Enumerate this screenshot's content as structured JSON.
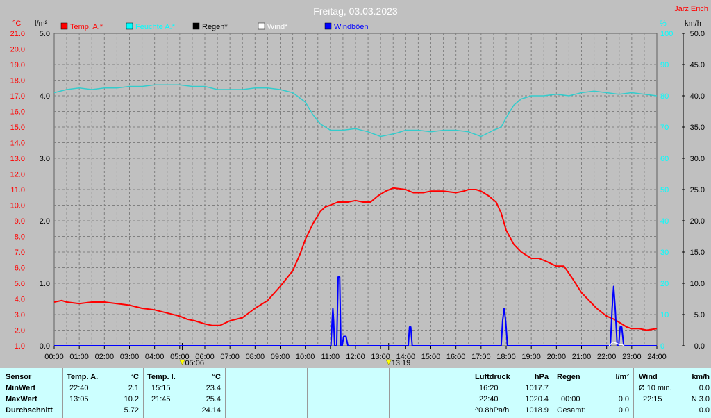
{
  "chart_data": {
    "type": "line",
    "title": "Freitag, 03.03.2023",
    "credit": "Jarz Erich",
    "x_ticks": [
      "00:00",
      "01:00",
      "02:00",
      "03:00",
      "04:00",
      "05:00",
      "06:00",
      "07:00",
      "08:00",
      "09:00",
      "10:00",
      "11:00",
      "12:00",
      "13:00",
      "14:00",
      "15:00",
      "16:00",
      "17:00",
      "18:00",
      "19:00",
      "20:00",
      "21:00",
      "22:00",
      "23:00",
      "24:00"
    ],
    "xlim": [
      0,
      24
    ],
    "axes": {
      "temp": {
        "unit": "°C",
        "min": 1.0,
        "max": 21.0,
        "ticks": [
          "1.0",
          "2.0",
          "3.0",
          "4.0",
          "5.0",
          "6.0",
          "7.0",
          "8.0",
          "9.0",
          "10.0",
          "11.0",
          "12.0",
          "13.0",
          "14.0",
          "15.0",
          "16.0",
          "17.0",
          "18.0",
          "19.0",
          "20.0",
          "21.0"
        ],
        "color": "#ff0000"
      },
      "rain": {
        "unit": "l/m²",
        "min": 0.0,
        "max": 5.0,
        "ticks": [
          "0.0",
          "1.0",
          "2.0",
          "3.0",
          "4.0",
          "5.0"
        ],
        "color": "#000000"
      },
      "humidity": {
        "unit": "%",
        "min": 0,
        "max": 100,
        "ticks": [
          "0",
          "10",
          "20",
          "30",
          "40",
          "50",
          "60",
          "70",
          "80",
          "90",
          "100"
        ],
        "color": "#00ffff"
      },
      "wind": {
        "unit": "km/h",
        "min": 0.0,
        "max": 50.0,
        "ticks": [
          "0.0",
          "5.0",
          "10.0",
          "15.0",
          "20.0",
          "25.0",
          "30.0",
          "35.0",
          "40.0",
          "45.0",
          "50.0"
        ],
        "color": "#000000"
      }
    },
    "legend": [
      {
        "name": "Temp. A.*",
        "color": "#ff0000"
      },
      {
        "name": "Feuchte A.*",
        "color": "#00ffff"
      },
      {
        "name": "Regen*",
        "color": "#000000"
      },
      {
        "name": "Wind*",
        "color": "#ffffff"
      },
      {
        "name": "Windböen",
        "color": "#0000ff"
      }
    ],
    "markers": [
      {
        "label": "05:06",
        "x": 5.1
      },
      {
        "label": "13:19",
        "x": 13.32
      }
    ],
    "series": [
      {
        "name": "Temp. A.*",
        "axis": "temp",
        "color": "#ff0000",
        "x": [
          0,
          0.3,
          0.5,
          1,
          1.5,
          2,
          2.5,
          3,
          3.5,
          4,
          4.5,
          5,
          5.3,
          5.6,
          6,
          6.3,
          6.6,
          7,
          7.5,
          8,
          8.5,
          9,
          9.5,
          9.8,
          10,
          10.3,
          10.6,
          10.8,
          11,
          11.3,
          11.7,
          12,
          12.3,
          12.6,
          12.9,
          13.2,
          13.5,
          14,
          14.3,
          14.7,
          15,
          15.5,
          16,
          16.3,
          16.5,
          16.8,
          17,
          17.3,
          17.6,
          17.8,
          18,
          18.3,
          18.6,
          19,
          19.3,
          19.6,
          20,
          20.3,
          20.6,
          21,
          21.3,
          21.6,
          22,
          22.3,
          22.6,
          22.8,
          23,
          23.3,
          23.6,
          24
        ],
        "y": [
          3.8,
          3.9,
          3.8,
          3.7,
          3.8,
          3.8,
          3.7,
          3.6,
          3.4,
          3.3,
          3.1,
          2.9,
          2.7,
          2.6,
          2.4,
          2.3,
          2.3,
          2.6,
          2.8,
          3.4,
          3.9,
          4.8,
          5.8,
          6.9,
          7.8,
          8.8,
          9.6,
          9.9,
          10.0,
          10.2,
          10.2,
          10.3,
          10.2,
          10.2,
          10.6,
          10.9,
          11.1,
          11.0,
          10.8,
          10.8,
          10.9,
          10.9,
          10.8,
          10.9,
          11.0,
          11.0,
          10.9,
          10.6,
          10.2,
          9.5,
          8.4,
          7.5,
          7.0,
          6.6,
          6.6,
          6.4,
          6.1,
          6.1,
          5.4,
          4.4,
          3.9,
          3.4,
          2.9,
          2.7,
          2.4,
          2.2,
          2.1,
          2.1,
          2.0,
          2.1
        ]
      },
      {
        "name": "Feuchte A.*",
        "axis": "humidity",
        "color": "#33cccc",
        "x": [
          0,
          0.5,
          1,
          1.5,
          2,
          2.5,
          3,
          3.5,
          4,
          4.5,
          5,
          5.5,
          6,
          6.5,
          7,
          7.5,
          8,
          8.5,
          9,
          9.5,
          10,
          10.3,
          10.6,
          11,
          11.5,
          12,
          12.5,
          13,
          13.3,
          13.6,
          14,
          14.5,
          15,
          15.5,
          16,
          16.5,
          17,
          17.5,
          17.8,
          18,
          18.3,
          18.6,
          19,
          19.5,
          20,
          20.5,
          21,
          21.5,
          22,
          22.5,
          23,
          23.5,
          24
        ],
        "y": [
          81,
          82,
          82.5,
          82,
          82.5,
          82.5,
          83,
          83,
          83.5,
          83.5,
          83.5,
          83,
          83,
          82,
          82,
          82,
          82.5,
          82.5,
          82,
          81,
          78,
          74,
          71,
          69,
          69,
          69.5,
          68.5,
          67,
          67.5,
          68,
          69,
          69,
          68.5,
          69,
          69,
          68.5,
          67,
          69,
          70,
          73,
          77,
          79,
          80,
          80,
          80.5,
          80,
          81,
          81.5,
          81,
          80.5,
          81,
          80.5,
          80
        ]
      },
      {
        "name": "Windböen",
        "axis": "wind",
        "color": "#0000ff",
        "x": [
          0,
          11.02,
          11.07,
          11.1,
          11.13,
          11.17,
          11.25,
          11.31,
          11.37,
          11.42,
          11.47,
          11.53,
          11.58,
          11.62,
          11.7,
          11.8,
          11.9,
          12,
          14.1,
          14.15,
          14.2,
          14.26,
          14.32,
          17.8,
          17.86,
          17.92,
          17.98,
          18.05,
          22.15,
          22.22,
          22.28,
          22.34,
          22.42,
          22.48,
          22.54,
          22.6,
          22.68,
          24
        ],
        "y": [
          0,
          0,
          4,
          6,
          4,
          0,
          0,
          11,
          11,
          0,
          0,
          1.5,
          1.5,
          1.5,
          0,
          0,
          0,
          0,
          0,
          3,
          3,
          0,
          0,
          0,
          4,
          6,
          4,
          0,
          0,
          6,
          9.5,
          6,
          0,
          0,
          3,
          3,
          0,
          0
        ]
      },
      {
        "name": "Wind*",
        "axis": "wind",
        "color": "#ffffff",
        "x": [
          22.1,
          22.25,
          22.4,
          22.5,
          22.6,
          22.7
        ],
        "y": [
          0,
          0.6,
          0.4,
          0.2,
          0.2,
          0
        ]
      }
    ]
  },
  "panel": {
    "sensor": {
      "h1": "Sensor",
      "r1": "MinWert",
      "r2": "MaxWert",
      "r3": "Durchschnitt"
    },
    "tempA": {
      "h1": "Temp. A.",
      "h2": "°C",
      "min_t": "22:40",
      "min_v": "2.1",
      "max_t": "13:05",
      "max_v": "10.2",
      "avg_v": "5.72"
    },
    "tempI": {
      "h1": "Temp. I.",
      "h2": "°C",
      "min_t": "15:15",
      "min_v": "23.4",
      "max_t": "21:45",
      "max_v": "25.4",
      "avg_v": "24.14"
    },
    "pressure": {
      "h1": "Luftdruck",
      "h2": "hPa",
      "min_t": "16:20",
      "min_v": "1017.7",
      "max_t": "22:40",
      "max_v": "1020.4",
      "avg_t": "^0.8hPa/h",
      "avg_v": "1018.9"
    },
    "rain": {
      "h1": "Regen",
      "h2": "l/m²",
      "max_t": "00:00",
      "max_v": "0.0",
      "avg_t": "Gesamt:",
      "avg_v": "0.0"
    },
    "wind": {
      "h1": "Wind",
      "h2": "km/h",
      "min_t": "Ø 10 min.",
      "min_v": "0.0",
      "max_t": "22:15",
      "max_v": "N 3.0",
      "avg_v": "0.0"
    }
  }
}
